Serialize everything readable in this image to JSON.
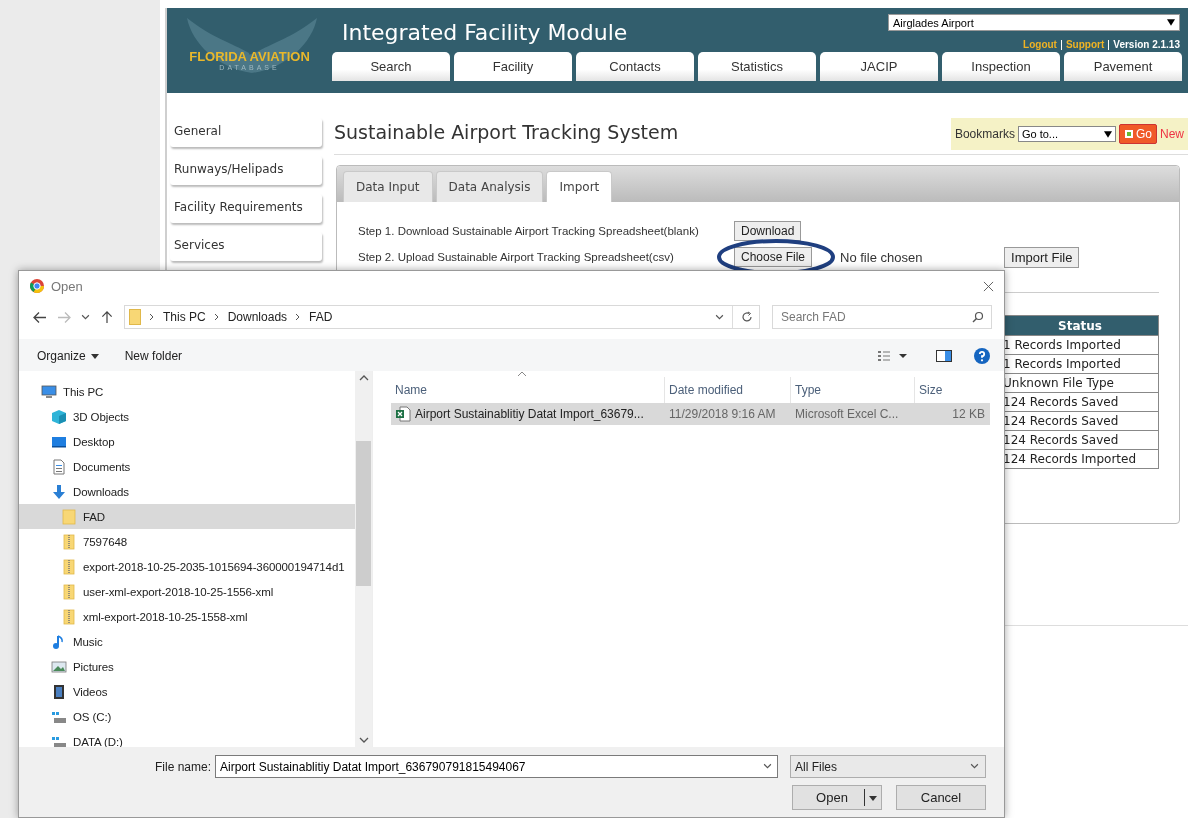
{
  "header": {
    "logo_title": "FLORIDA AVIATION",
    "logo_subtitle": "DATABASE",
    "title": "Integrated Facility Module",
    "airport_select": "Airglades Airport",
    "links": [
      "Logout",
      "Support"
    ],
    "version": "Version 2.1.13"
  },
  "nav_tabs": [
    {
      "label": "Search",
      "selected": false
    },
    {
      "label": "Facility",
      "selected": true
    },
    {
      "label": "Contacts",
      "selected": false
    },
    {
      "label": "Statistics",
      "selected": false
    },
    {
      "label": "JACIP",
      "selected": false
    },
    {
      "label": "Inspection",
      "selected": false
    },
    {
      "label": "Pavement",
      "selected": false
    }
  ],
  "sidebar": {
    "items": [
      "General",
      "Runways/Helipads",
      "Facility Requirements",
      "Services"
    ]
  },
  "page_title": "Sustainable Airport Tracking System",
  "bookmarks": {
    "label": "Bookmarks",
    "select": "Go to...",
    "go": "Go",
    "new": "New"
  },
  "sub_tabs": [
    {
      "label": "Data Input",
      "selected": false
    },
    {
      "label": "Data Analysis",
      "selected": false
    },
    {
      "label": "Import",
      "selected": true
    }
  ],
  "steps": [
    {
      "text": "Step 1. Download Sustainable Airport Tracking Spreadsheet(blank)",
      "button": "Download"
    },
    {
      "text": "Step 2. Upload Sustainable Airport Tracking Spreadsheet(csv)",
      "button": "Choose File",
      "status": "No file chosen"
    }
  ],
  "import_button": "Import File",
  "status_table": {
    "columns": [
      "Status"
    ],
    "rows": [
      "1 Records Imported",
      "1 Records Imported",
      "Unknown File Type",
      "124 Records Saved",
      "124 Records Saved",
      "124 Records Saved",
      "124 Records Imported"
    ]
  },
  "dialog": {
    "title": "Open",
    "breadcrumb": [
      "This PC",
      "Downloads",
      "FAD"
    ],
    "search": {
      "placeholder": "Search FAD"
    },
    "toolbar": [
      "Organize",
      "New folder"
    ],
    "tree": [
      {
        "label": "This PC",
        "kind": "computer",
        "selected": false,
        "children": [
          {
            "label": "3D Objects",
            "kind": "cube",
            "selected": false
          },
          {
            "label": "Desktop",
            "kind": "desktop",
            "selected": false
          },
          {
            "label": "Documents",
            "kind": "document",
            "selected": false
          },
          {
            "label": "Downloads",
            "kind": "download",
            "selected": false,
            "children": [
              {
                "label": "FAD",
                "kind": "folder",
                "selected": true
              },
              {
                "label": "7597648",
                "kind": "zip",
                "selected": false
              },
              {
                "label": "export-2018-10-25-2035-1015694-360000194714d1",
                "kind": "zip",
                "selected": false
              },
              {
                "label": "user-xml-export-2018-10-25-1556-xml",
                "kind": "zip",
                "selected": false
              },
              {
                "label": "xml-export-2018-10-25-1558-xml",
                "kind": "zip",
                "selected": false
              }
            ]
          },
          {
            "label": "Music",
            "kind": "music",
            "selected": false
          },
          {
            "label": "Pictures",
            "kind": "pictures",
            "selected": false
          },
          {
            "label": "Videos",
            "kind": "videos",
            "selected": false
          },
          {
            "label": "OS (C:)",
            "kind": "drive",
            "selected": false
          },
          {
            "label": "DATA (D:)",
            "kind": "drive",
            "selected": false
          }
        ]
      }
    ],
    "columns": [
      "Name",
      "Date modified",
      "Type",
      "Size"
    ],
    "files": [
      {
        "name": "Airport Sustainablitiy Datat Import_63679...",
        "date": "11/29/2018 9:16 AM",
        "type": "Microsoft Excel C...",
        "size": "12 KB",
        "selected": true
      }
    ],
    "file_name_label": "File name:",
    "file_name": "Airport Sustainablitiy Datat Import_636790791815494067",
    "filter": "All Files",
    "buttons": [
      "Open",
      "Cancel"
    ]
  }
}
